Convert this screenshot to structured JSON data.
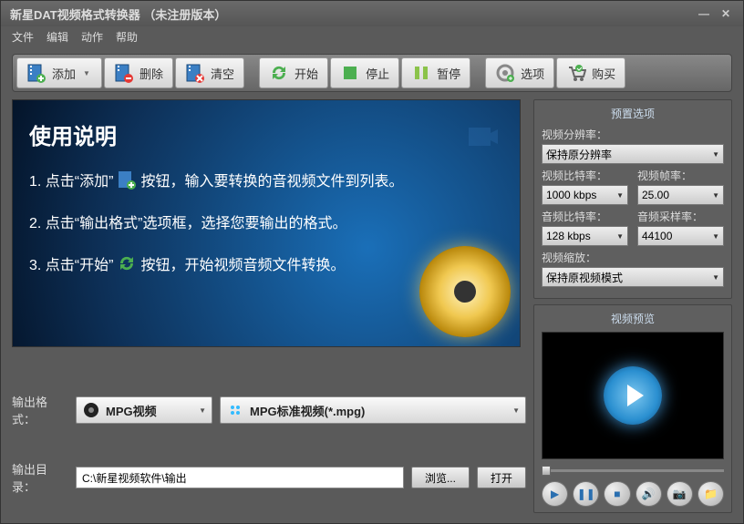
{
  "title": "新星DAT视频格式转换器  （未注册版本）",
  "menu": {
    "file": "文件",
    "edit": "编辑",
    "action": "动作",
    "help": "帮助"
  },
  "toolbar": {
    "add": "添加",
    "delete": "删除",
    "clear": "清空",
    "start": "开始",
    "stop": "停止",
    "pause": "暂停",
    "options": "选项",
    "buy": "购买"
  },
  "instructions": {
    "title": "使用说明",
    "s1a": "1. 点击“添加”",
    "s1b": "按钮，输入要转换的音视频文件到列表。",
    "s2": "2. 点击“输出格式”选项框，选择您要输出的格式。",
    "s3a": "3. 点击“开始”",
    "s3b": "按钮，开始视频音频文件转换。"
  },
  "output": {
    "format_label": "输出格式：",
    "format_sel": "MPG视频",
    "preset_sel": "MPG标准视频(*.mpg)",
    "dir_label": "输出目录：",
    "dir_value": "C:\\新星视频软件\\输出",
    "browse": "浏览...",
    "open": "打开"
  },
  "presets": {
    "title": "预置选项",
    "res_label": "视频分辨率：",
    "res_val": "保持原分辨率",
    "vbit_label": "视频比特率：",
    "vbit_val": "1000 kbps",
    "vfps_label": "视频帧率：",
    "vfps_val": "25.00",
    "abit_label": "音频比特率：",
    "abit_val": "128 kbps",
    "asr_label": "音频采样率：",
    "asr_val": "44100",
    "scale_label": "视频缩放：",
    "scale_val": "保持原视频模式"
  },
  "preview": {
    "title": "视频预览"
  }
}
